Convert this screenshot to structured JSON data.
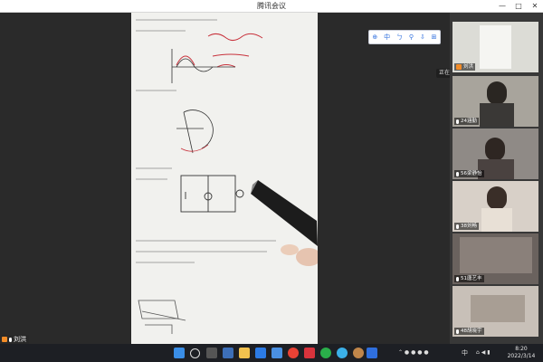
{
  "window": {
    "title": "腾讯会议",
    "min_label": "—",
    "max_label": "□",
    "close_label": "✕"
  },
  "toolbar": {
    "items": [
      "⊕",
      "中",
      "ㄅ",
      "⚲",
      "⇩",
      "⊞"
    ]
  },
  "presenter": {
    "name": "刘洪",
    "icon": "mic-icon"
  },
  "speaking": {
    "label": "正在讲话: 刘洪"
  },
  "participants": [
    {
      "name": "刘洪",
      "kind": "screen"
    },
    {
      "name": "24涵勤"
    },
    {
      "name": "56梁静怡"
    },
    {
      "name": "38刘畅"
    },
    {
      "name": "51唐艺丰"
    },
    {
      "name": "48胡晓宇"
    }
  ],
  "taskbar": {
    "apps": [
      "windows-icon",
      "search-icon",
      "task-view-icon",
      "widgets-icon",
      "file-explorer-icon",
      "mail-icon",
      "store-icon",
      "chrome-icon",
      "wps-icon",
      "wechat-icon",
      "qq-icon",
      "app-icon",
      "tencent-meeting-icon"
    ],
    "tray": {
      "ime": "中",
      "time": "8:20",
      "date": "2022/3/14"
    }
  },
  "colors": {
    "accent": "#2f6fde",
    "taskbar": "#1d1f24",
    "orange": "#f28c28"
  }
}
